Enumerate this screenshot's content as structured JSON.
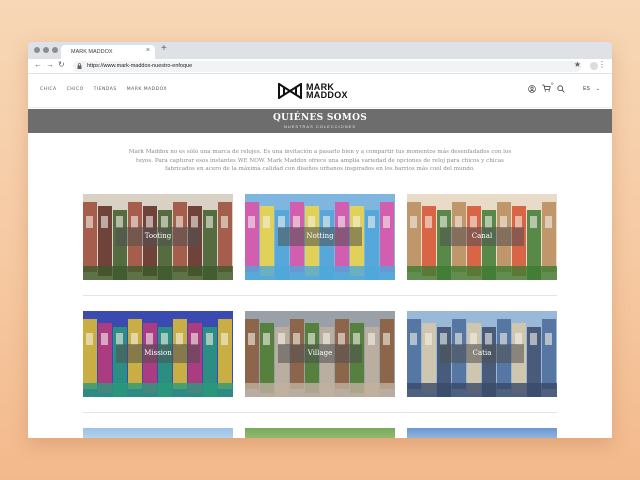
{
  "browser": {
    "tab_title": "MARK MADDOX",
    "tab_close": "×",
    "new_tab": "+",
    "url": "https://www.mark-maddox-nuestro-enfoque"
  },
  "site": {
    "nav": [
      "CHICA",
      "CHICO",
      "TIENDAS",
      "MARK MADDOX"
    ],
    "logo_line1": "MARK",
    "logo_line2": "MADDOX",
    "language": "ES",
    "cart_count": "0"
  },
  "banner": {
    "title": "QUIÉNES SOMOS",
    "subtitle": "NUESTRAS COLECCIONES"
  },
  "intro": "Mark Maddox no es sólo una marca de relojes. Es una invitación a pasarlo bien y a compartir tus momentos más desenfadados con los tuyos. Para capturar esos instantes WE NOW. Mark Maddox ofrece una amplia variedad de opciones de reloj para chicos y chicas fabricados en acero de la máxima calidad con diseños urbanos inspirados en los barrios más cool del mundo.",
  "collections": [
    {
      "label": "Tooting",
      "colors": [
        "#d9d2c4",
        "#9a4a36",
        "#5c2a22",
        "#3d5a2a"
      ]
    },
    {
      "label": "Notting",
      "colors": [
        "#7fb6e0",
        "#e04fa6",
        "#f2d640",
        "#4fa6d8"
      ]
    },
    {
      "label": "Canal",
      "colors": [
        "#e8dcc8",
        "#b88a5a",
        "#d65030",
        "#3f7a32"
      ]
    },
    {
      "label": "Mission",
      "colors": [
        "#3a4ab0",
        "#e2c030",
        "#c03a7a",
        "#2a9a7a"
      ]
    },
    {
      "label": "Village",
      "colors": [
        "#9aa0a8",
        "#8a5a3a",
        "#4a7a2a",
        "#c0b0a0"
      ]
    },
    {
      "label": "Catia",
      "colors": [
        "#9ab8d8",
        "#4a6a9a",
        "#d8c8a8",
        "#3a4a6a"
      ]
    }
  ],
  "accent_color": "#6d6d6d"
}
